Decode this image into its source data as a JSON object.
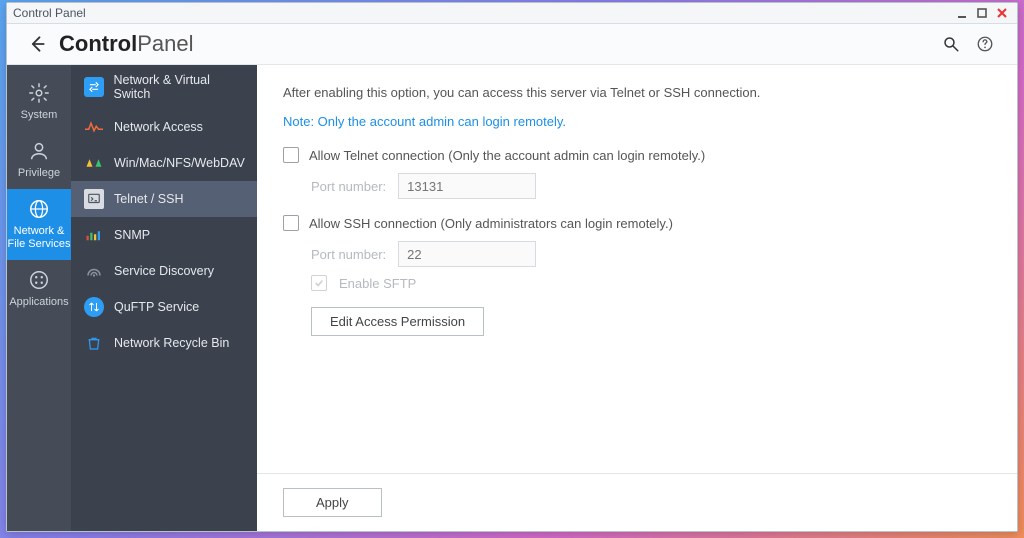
{
  "window": {
    "title": "Control Panel"
  },
  "header": {
    "brand_bold": "Control",
    "brand_light": "Panel"
  },
  "nav1": {
    "items": [
      {
        "key": "system",
        "label": "System"
      },
      {
        "key": "privilege",
        "label": "Privilege"
      },
      {
        "key": "network",
        "label": "Network & File Services"
      },
      {
        "key": "applications",
        "label": "Applications"
      }
    ]
  },
  "nav2": {
    "items": [
      {
        "key": "nvs",
        "label": "Network & Virtual Switch"
      },
      {
        "key": "netaccess",
        "label": "Network Access"
      },
      {
        "key": "wmnw",
        "label": "Win/Mac/NFS/WebDAV"
      },
      {
        "key": "telnet",
        "label": "Telnet / SSH"
      },
      {
        "key": "snmp",
        "label": "SNMP"
      },
      {
        "key": "svcdisc",
        "label": "Service Discovery"
      },
      {
        "key": "quftp",
        "label": "QuFTP Service"
      },
      {
        "key": "recycle",
        "label": "Network Recycle Bin"
      }
    ]
  },
  "content": {
    "description": "After enabling this option, you can access this server via Telnet or SSH connection.",
    "note": "Note: Only the account admin can login remotely.",
    "telnet": {
      "label": "Allow Telnet connection (Only the account admin can login remotely.)",
      "port_label": "Port number:",
      "port_value": "13131"
    },
    "ssh": {
      "label": "Allow SSH connection (Only administrators can login remotely.)",
      "port_label": "Port number:",
      "port_value": "22",
      "sftp_label": "Enable SFTP",
      "edit_btn": "Edit Access Permission"
    },
    "apply": "Apply"
  }
}
